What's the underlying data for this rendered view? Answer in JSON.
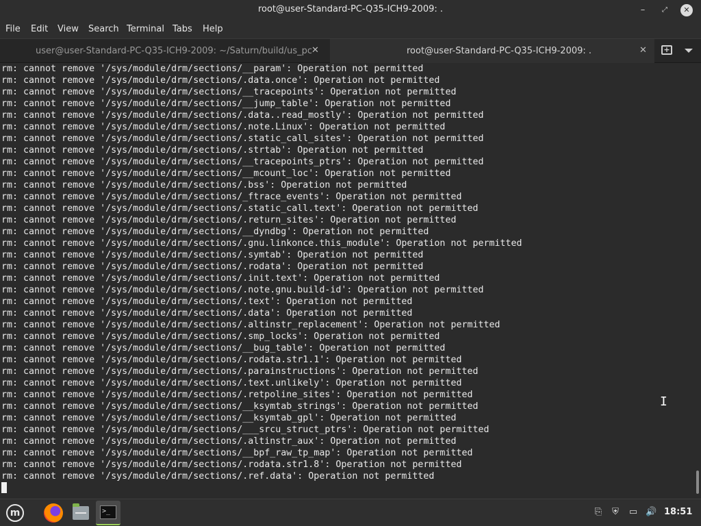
{
  "window": {
    "title": "root@user-Standard-PC-Q35-ICH9-2009: .",
    "controls": {
      "minimize": "–",
      "maximize": "⤢",
      "close": "✕"
    }
  },
  "menu": [
    "File",
    "Edit",
    "View",
    "Search",
    "Terminal",
    "Tabs",
    "Help"
  ],
  "tabs": [
    {
      "label": "user@user-Standard-PC-Q35-ICH9-2009: ~/Saturn/build/us_pc",
      "active": false
    },
    {
      "label": "root@user-Standard-PC-Q35-ICH9-2009: .",
      "active": true
    }
  ],
  "tab_close_glyph": "✕",
  "terminal": {
    "lines": [
      "rm: cannot remove '/sys/module/drm/sections/__param': Operation not permitted",
      "rm: cannot remove '/sys/module/drm/sections/.data.once': Operation not permitted",
      "rm: cannot remove '/sys/module/drm/sections/__tracepoints': Operation not permitted",
      "rm: cannot remove '/sys/module/drm/sections/__jump_table': Operation not permitted",
      "rm: cannot remove '/sys/module/drm/sections/.data..read_mostly': Operation not permitted",
      "rm: cannot remove '/sys/module/drm/sections/.note.Linux': Operation not permitted",
      "rm: cannot remove '/sys/module/drm/sections/.static_call_sites': Operation not permitted",
      "rm: cannot remove '/sys/module/drm/sections/.strtab': Operation not permitted",
      "rm: cannot remove '/sys/module/drm/sections/__tracepoints_ptrs': Operation not permitted",
      "rm: cannot remove '/sys/module/drm/sections/__mcount_loc': Operation not permitted",
      "rm: cannot remove '/sys/module/drm/sections/.bss': Operation not permitted",
      "rm: cannot remove '/sys/module/drm/sections/_ftrace_events': Operation not permitted",
      "rm: cannot remove '/sys/module/drm/sections/.static_call.text': Operation not permitted",
      "rm: cannot remove '/sys/module/drm/sections/.return_sites': Operation not permitted",
      "rm: cannot remove '/sys/module/drm/sections/__dyndbg': Operation not permitted",
      "rm: cannot remove '/sys/module/drm/sections/.gnu.linkonce.this_module': Operation not permitted",
      "rm: cannot remove '/sys/module/drm/sections/.symtab': Operation not permitted",
      "rm: cannot remove '/sys/module/drm/sections/.rodata': Operation not permitted",
      "rm: cannot remove '/sys/module/drm/sections/.init.text': Operation not permitted",
      "rm: cannot remove '/sys/module/drm/sections/.note.gnu.build-id': Operation not permitted",
      "rm: cannot remove '/sys/module/drm/sections/.text': Operation not permitted",
      "rm: cannot remove '/sys/module/drm/sections/.data': Operation not permitted",
      "rm: cannot remove '/sys/module/drm/sections/.altinstr_replacement': Operation not permitted",
      "rm: cannot remove '/sys/module/drm/sections/.smp_locks': Operation not permitted",
      "rm: cannot remove '/sys/module/drm/sections/__bug_table': Operation not permitted",
      "rm: cannot remove '/sys/module/drm/sections/.rodata.str1.1': Operation not permitted",
      "rm: cannot remove '/sys/module/drm/sections/.parainstructions': Operation not permitted",
      "rm: cannot remove '/sys/module/drm/sections/.text.unlikely': Operation not permitted",
      "rm: cannot remove '/sys/module/drm/sections/.retpoline_sites': Operation not permitted",
      "rm: cannot remove '/sys/module/drm/sections/__ksymtab_strings': Operation not permitted",
      "rm: cannot remove '/sys/module/drm/sections/__ksymtab_gpl': Operation not permitted",
      "rm: cannot remove '/sys/module/drm/sections/___srcu_struct_ptrs': Operation not permitted",
      "rm: cannot remove '/sys/module/drm/sections/.altinstr_aux': Operation not permitted",
      "rm: cannot remove '/sys/module/drm/sections/__bpf_raw_tp_map': Operation not permitted",
      "rm: cannot remove '/sys/module/drm/sections/.rodata.str1.8': Operation not permitted",
      "rm: cannot remove '/sys/module/drm/sections/.ref.data': Operation not permitted"
    ],
    "background": "#2b2b2b",
    "foreground": "#e8e8e8"
  },
  "taskbar": {
    "apps": [
      "mint-menu-icon",
      "firefox-icon",
      "files-icon",
      "terminal-icon"
    ],
    "terminal_glyph": ">_",
    "tray": [
      "clipboard-icon",
      "shield-icon",
      "network-icon",
      "volume-icon"
    ],
    "tray_glyphs": {
      "clipboard": "⎘",
      "shield": "⛨",
      "network": "▭",
      "volume": "🔊"
    },
    "clock": "18:51",
    "accent": "#9bd05a"
  }
}
